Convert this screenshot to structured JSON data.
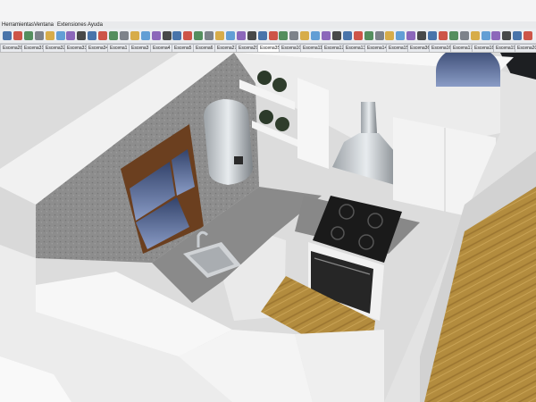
{
  "app": {
    "menu": [
      "Herramientas",
      "Ventana",
      "Extensiones",
      "Ayuda"
    ]
  },
  "toolbar": {
    "tools": [
      "select-icon",
      "eraser-icon",
      "paint-bucket-icon",
      "component-icon",
      "rectangle-icon",
      "line-icon",
      "arc-icon",
      "push-pull-icon",
      "move-icon",
      "rotate-icon",
      "scale-icon",
      "offset-icon",
      "tape-measure-icon",
      "dimension-icon",
      "text-icon",
      "section-plane-icon",
      "orbit-icon",
      "pan-icon",
      "zoom-icon",
      "zoom-extents-icon",
      "camera-icon",
      "walk-icon",
      "look-around-icon",
      "sandbox-icon",
      "iso-view-icon",
      "top-view-icon",
      "front-view-icon",
      "right-view-icon",
      "back-view-icon",
      "left-view-icon",
      "xray-icon",
      "wireframe-icon",
      "hidden-line-icon",
      "shaded-icon",
      "textured-icon",
      "monochrome-icon",
      "shadow-icon",
      "fog-icon",
      "warehouse-icon",
      "extension-icon",
      "layout-icon",
      "style-icon",
      "scene-icon",
      "solid-tools-icon",
      "intersect-icon",
      "union-icon",
      "subtract-icon",
      "trim-icon",
      "split-icon",
      "outer-shell-icon"
    ]
  },
  "scene_tabs": [
    {
      "label": "Escena28",
      "active": false
    },
    {
      "label": "Escena31",
      "active": false
    },
    {
      "label": "Escena32",
      "active": false
    },
    {
      "label": "Escena33",
      "active": false
    },
    {
      "label": "Escena34",
      "active": false
    },
    {
      "label": "Escena1",
      "active": false
    },
    {
      "label": "Escena3",
      "active": false
    },
    {
      "label": "Escena4",
      "active": false
    },
    {
      "label": "Escena5",
      "active": false
    },
    {
      "label": "Escena6",
      "active": false
    },
    {
      "label": "Escena27",
      "active": false
    },
    {
      "label": "Escena29",
      "active": false
    },
    {
      "label": "Escena35",
      "active": true
    },
    {
      "label": "Escena10",
      "active": false
    },
    {
      "label": "Escena11",
      "active": false
    },
    {
      "label": "Escena12",
      "active": false
    },
    {
      "label": "Escena13",
      "active": false
    },
    {
      "label": "Escena14",
      "active": false
    },
    {
      "label": "Escena15",
      "active": false
    },
    {
      "label": "Escena36",
      "active": false
    },
    {
      "label": "Escena16",
      "active": false
    },
    {
      "label": "Escena17",
      "active": false
    },
    {
      "label": "Escena18",
      "active": false
    },
    {
      "label": "Escena19",
      "active": false
    },
    {
      "label": "Escena20",
      "active": false
    }
  ],
  "viewport": {
    "scene": "3d-kitchen-model",
    "colors": {
      "wall_top": "#f2f2f2",
      "wall_side": "#d8d8d8",
      "wall_texture": "#8a8a8a",
      "floor_wood": "#b08a3a",
      "countertop": "#8c8c8c",
      "cooktop": "#1a1a1a"
    }
  }
}
